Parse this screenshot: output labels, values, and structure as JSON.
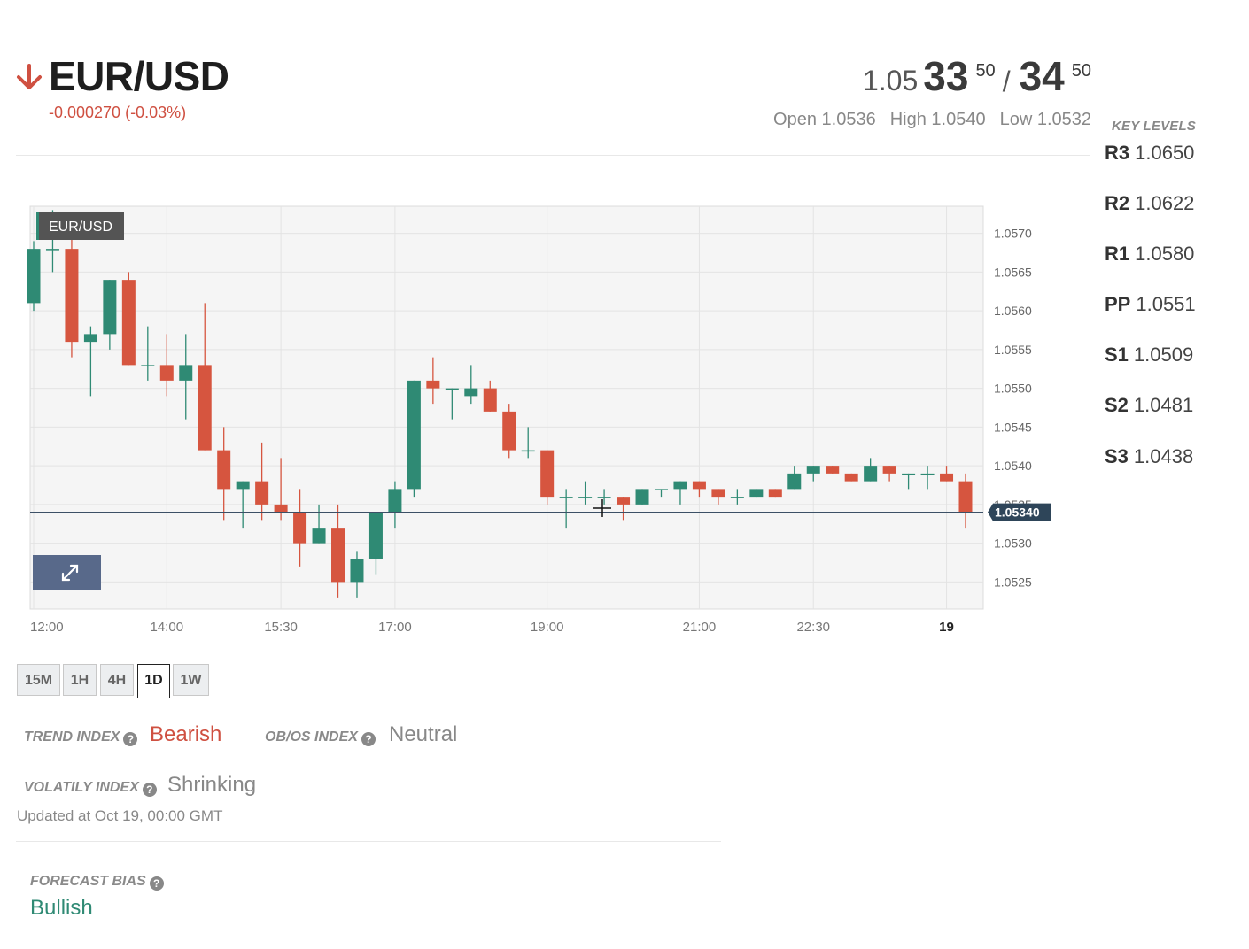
{
  "header": {
    "pair": "EUR/USD",
    "change": "-0.000270 (-0.03%)",
    "arrow_icon": "arrow-down-icon",
    "bid": {
      "prefix": "1.05",
      "big": "33",
      "pip": "50"
    },
    "ask": {
      "big": "34",
      "pip": "50"
    },
    "separator": "/",
    "open": "Open 1.0536",
    "high": "High 1.0540",
    "low": "Low 1.0532"
  },
  "key_levels": {
    "title": "KEY LEVELS",
    "levels": [
      {
        "name": "R3",
        "value": "1.0650"
      },
      {
        "name": "R2",
        "value": "1.0622"
      },
      {
        "name": "R1",
        "value": "1.0580"
      },
      {
        "name": "PP",
        "value": "1.0551"
      },
      {
        "name": "S1",
        "value": "1.0509"
      },
      {
        "name": "S2",
        "value": "1.0481"
      },
      {
        "name": "S3",
        "value": "1.0438"
      }
    ]
  },
  "chart": {
    "legend": "EUR/USD",
    "current_price_label": "1.05340",
    "current_price": 1.0534,
    "expand_icon": "expand-icon",
    "colors": {
      "up": "#2f8a74",
      "down": "#d6553f",
      "grid": "#e3e3e3",
      "bg": "#f5f5f5",
      "price_line": "#3c5066",
      "price_tag": "#2e4559"
    }
  },
  "chart_data": {
    "type": "candlestick",
    "title": "EUR/USD",
    "y_ticks": [
      "1.0525",
      "1.0530",
      "1.0535",
      "1.0540",
      "1.0545",
      "1.0550",
      "1.0555",
      "1.0560",
      "1.0565",
      "1.0570"
    ],
    "ylim": [
      1.05215,
      1.05735
    ],
    "x_ticks": [
      "12:00",
      "14:00",
      "15:30",
      "17:00",
      "19:00",
      "21:00",
      "22:30",
      "19"
    ],
    "grid": true,
    "candles": [
      {
        "o": 1.0561,
        "h": 1.0569,
        "l": 1.056,
        "c": 1.0568
      },
      {
        "o": 1.0568,
        "h": 1.0573,
        "l": 1.0565,
        "c": 1.0568
      },
      {
        "o": 1.0568,
        "h": 1.0571,
        "l": 1.0554,
        "c": 1.0556
      },
      {
        "o": 1.0556,
        "h": 1.0558,
        "l": 1.0549,
        "c": 1.0557
      },
      {
        "o": 1.0557,
        "h": 1.0564,
        "l": 1.0555,
        "c": 1.0564
      },
      {
        "o": 1.0564,
        "h": 1.0565,
        "l": 1.0553,
        "c": 1.0553
      },
      {
        "o": 1.0553,
        "h": 1.0558,
        "l": 1.0551,
        "c": 1.0553
      },
      {
        "o": 1.0553,
        "h": 1.0557,
        "l": 1.0549,
        "c": 1.0551
      },
      {
        "o": 1.0551,
        "h": 1.0557,
        "l": 1.0546,
        "c": 1.0553
      },
      {
        "o": 1.0553,
        "h": 1.0561,
        "l": 1.0542,
        "c": 1.0542
      },
      {
        "o": 1.0542,
        "h": 1.0545,
        "l": 1.0533,
        "c": 1.0537
      },
      {
        "o": 1.0537,
        "h": 1.0538,
        "l": 1.0532,
        "c": 1.0538
      },
      {
        "o": 1.0538,
        "h": 1.0543,
        "l": 1.0533,
        "c": 1.0535
      },
      {
        "o": 1.0535,
        "h": 1.0541,
        "l": 1.0533,
        "c": 1.0534
      },
      {
        "o": 1.0534,
        "h": 1.0537,
        "l": 1.0527,
        "c": 1.053
      },
      {
        "o": 1.053,
        "h": 1.0535,
        "l": 1.053,
        "c": 1.0532
      },
      {
        "o": 1.0532,
        "h": 1.0535,
        "l": 1.0523,
        "c": 1.0525
      },
      {
        "o": 1.0525,
        "h": 1.0529,
        "l": 1.0523,
        "c": 1.0528
      },
      {
        "o": 1.0528,
        "h": 1.0534,
        "l": 1.0526,
        "c": 1.0534
      },
      {
        "o": 1.0534,
        "h": 1.0538,
        "l": 1.0532,
        "c": 1.0537
      },
      {
        "o": 1.0537,
        "h": 1.0551,
        "l": 1.0536,
        "c": 1.0551
      },
      {
        "o": 1.0551,
        "h": 1.0554,
        "l": 1.0548,
        "c": 1.055
      },
      {
        "o": 1.055,
        "h": 1.055,
        "l": 1.0546,
        "c": 1.055
      },
      {
        "o": 1.0549,
        "h": 1.0553,
        "l": 1.0548,
        "c": 1.055
      },
      {
        "o": 1.055,
        "h": 1.0551,
        "l": 1.0547,
        "c": 1.0547
      },
      {
        "o": 1.0547,
        "h": 1.0548,
        "l": 1.0541,
        "c": 1.0542
      },
      {
        "o": 1.0542,
        "h": 1.0545,
        "l": 1.0541,
        "c": 1.0542
      },
      {
        "o": 1.0542,
        "h": 1.0542,
        "l": 1.0535,
        "c": 1.0536
      },
      {
        "o": 1.0536,
        "h": 1.0537,
        "l": 1.0532,
        "c": 1.0536
      },
      {
        "o": 1.0536,
        "h": 1.0538,
        "l": 1.0535,
        "c": 1.0536
      },
      {
        "o": 1.0536,
        "h": 1.0537,
        "l": 1.0535,
        "c": 1.0536
      },
      {
        "o": 1.0536,
        "h": 1.0536,
        "l": 1.0533,
        "c": 1.0535
      },
      {
        "o": 1.0535,
        "h": 1.0537,
        "l": 1.0535,
        "c": 1.0537
      },
      {
        "o": 1.0537,
        "h": 1.0537,
        "l": 1.0536,
        "c": 1.0537
      },
      {
        "o": 1.0537,
        "h": 1.0538,
        "l": 1.0535,
        "c": 1.0538
      },
      {
        "o": 1.0538,
        "h": 1.0538,
        "l": 1.0536,
        "c": 1.0537
      },
      {
        "o": 1.0537,
        "h": 1.0537,
        "l": 1.0535,
        "c": 1.0536
      },
      {
        "o": 1.0536,
        "h": 1.0537,
        "l": 1.0535,
        "c": 1.0536
      },
      {
        "o": 1.0536,
        "h": 1.0537,
        "l": 1.0536,
        "c": 1.0537
      },
      {
        "o": 1.0537,
        "h": 1.0537,
        "l": 1.0536,
        "c": 1.0536
      },
      {
        "o": 1.0537,
        "h": 1.054,
        "l": 1.0537,
        "c": 1.0539
      },
      {
        "o": 1.0539,
        "h": 1.054,
        "l": 1.0538,
        "c": 1.054
      },
      {
        "o": 1.054,
        "h": 1.054,
        "l": 1.0539,
        "c": 1.0539
      },
      {
        "o": 1.0539,
        "h": 1.0539,
        "l": 1.0538,
        "c": 1.0538
      },
      {
        "o": 1.0538,
        "h": 1.0541,
        "l": 1.0538,
        "c": 1.054
      },
      {
        "o": 1.054,
        "h": 1.054,
        "l": 1.0538,
        "c": 1.0539
      },
      {
        "o": 1.0539,
        "h": 1.0539,
        "l": 1.0537,
        "c": 1.0539
      },
      {
        "o": 1.0539,
        "h": 1.054,
        "l": 1.0537,
        "c": 1.0539
      },
      {
        "o": 1.0539,
        "h": 1.054,
        "l": 1.0538,
        "c": 1.0538
      },
      {
        "o": 1.0538,
        "h": 1.0539,
        "l": 1.0532,
        "c": 1.0534
      }
    ]
  },
  "timeframes": {
    "tabs": [
      "15M",
      "1H",
      "4H",
      "1D",
      "1W"
    ],
    "active": "1D"
  },
  "indices": {
    "trend": {
      "label": "TREND INDEX",
      "value": "Bearish"
    },
    "obos": {
      "label": "OB/OS INDEX",
      "value": "Neutral"
    },
    "volatility": {
      "label": "VOLATILY INDEX",
      "value": "Shrinking"
    },
    "help_icon": "question-circle-icon",
    "updated": "Updated at Oct 19, 00:00 GMT"
  },
  "forecast": {
    "label": "FORECAST BIAS",
    "value": "Bullish"
  },
  "colors": {
    "bearish": "#cf5041",
    "bullish": "#2f8a74",
    "neutral": "#888888"
  }
}
